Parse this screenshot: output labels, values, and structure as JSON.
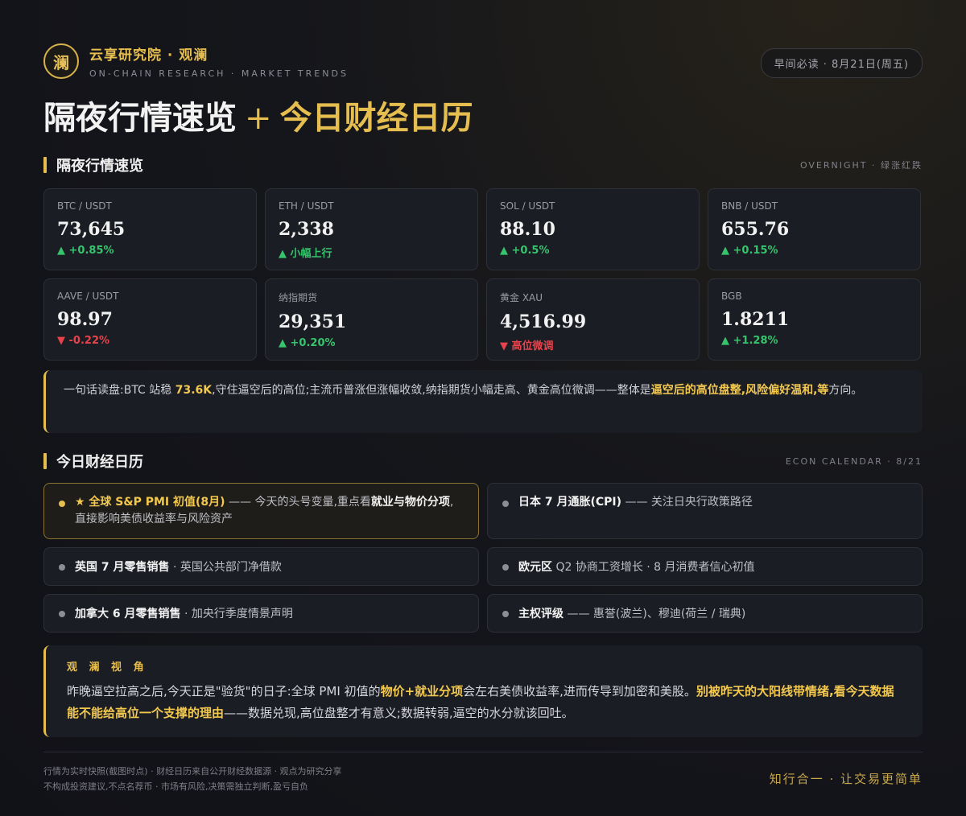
{
  "header": {
    "logo_char": "澜",
    "brand_name": "云享研究院 · 观澜",
    "brand_sub": "ON-CHAIN RESEARCH · MARKET TRENDS",
    "date_badge": "早间必读 · 8月21日(周五)",
    "title_main": "隔夜行情速览",
    "title_plus": "+",
    "title_accent": "今日财经日历"
  },
  "overnight": {
    "title": "隔夜行情速览",
    "tag": "OVERNIGHT · 绿涨红跌",
    "cards": [
      {
        "pair": "BTC / USDT",
        "price": "73,645",
        "change": "▲ +0.85%",
        "direction": "up"
      },
      {
        "pair": "ETH / USDT",
        "price": "2,338",
        "change": "▲ 小幅上行",
        "direction": "up"
      },
      {
        "pair": "SOL / USDT",
        "price": "88.10",
        "change": "▲ +0.5%",
        "direction": "up"
      },
      {
        "pair": "BNB / USDT",
        "price": "655.76",
        "change": "▲ +0.15%",
        "direction": "up"
      },
      {
        "pair": "AAVE / USDT",
        "price": "98.97",
        "change": "▼ -0.22%",
        "direction": "down"
      },
      {
        "pair": "纳指期货",
        "price": "29,351",
        "change": "▲ +0.20%",
        "direction": "up"
      },
      {
        "pair": "黄金 XAU",
        "price": "4,516.99",
        "change": "▼ 高位微调",
        "direction": "down"
      },
      {
        "pair": "BGB",
        "price": "1.8211",
        "change": "▲ +1.28%",
        "direction": "up"
      }
    ],
    "summary": {
      "p1": "一句话读盘:BTC 站稳 ",
      "h1": "73.6K",
      "p2": ",守住逼空后的高位;主流币普涨但涨幅收敛,纳指期货小幅走高、黄金高位微调——整体是",
      "h2": "逼空后的高位盘整,风险偏好温和,等",
      "p3": "方向。"
    }
  },
  "calendar": {
    "title": "今日财经日历",
    "tag": "ECON CALENDAR · 8/21",
    "events": [
      {
        "strong": "★ 全球 S&P PMI 初值(8月)",
        "mid": " —— 今天的头号变量,重点看",
        "strong2": "就业与物价分项",
        "tail": ",",
        "line2": "直接影响美债收益率与风险资产"
      },
      {
        "strong": "日本 7 月通胀(CPI)",
        "tail": " —— 关注日央行政策路径"
      },
      {
        "strong": "英国 7 月零售销售",
        "tail": " · 英国公共部门净借款"
      },
      {
        "strong": "欧元区",
        "tail": " Q2 协商工资增长 · 8 月消费者信心初值"
      },
      {
        "strong": "加拿大 6 月零售销售",
        "tail": " · 加央行季度情景声明"
      },
      {
        "strong": "主权评级",
        "tail": " —— 惠誉(波兰)、穆迪(荷兰 / 瑞典)"
      }
    ]
  },
  "view": {
    "heading": "观 澜 视 角",
    "p1": "昨晚逼空拉高之后,今天正是\"验货\"的日子:全球 PMI 初值的",
    "h1": "物价+就业分项",
    "p2": "会左右美债收益率,进而传导到加密和美股。",
    "h2": "别被昨天的大阳线带情绪,看今天数据能不能给高位一个支撑的理由",
    "p3": "——数据兑现,高位盘整才有意义;数据转弱,逼空的水分就该回吐。"
  },
  "footer": {
    "line1": "行情为实时快照(截图时点) · 财经日历来自公开财经数据源 · 观点为研究分享",
    "line2": "不构成投资建议,不点名荐币 · 市场有风险,决策需独立判断,盈亏自负",
    "slogan": "知行合一 · 让交易更简单"
  },
  "colors": {
    "accent": "#e6bd4f",
    "up": "#36c46d",
    "down": "#e8424a",
    "background": "#111217"
  }
}
